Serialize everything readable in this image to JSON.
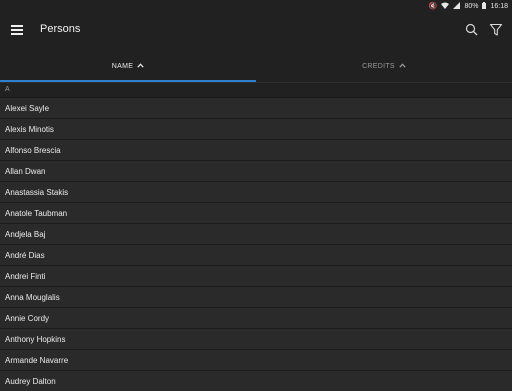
{
  "status_bar": {
    "battery": "80%",
    "time": "16:18",
    "icons": [
      "mute-icon",
      "wifi-icon",
      "signal-icon",
      "battery-icon"
    ]
  },
  "app_bar": {
    "title": "Persons",
    "icons": [
      "menu-icon",
      "search-icon",
      "filter-icon"
    ]
  },
  "tabs": [
    {
      "label": "NAME",
      "sort_arrow": "up",
      "active": true
    },
    {
      "label": "CREDITS",
      "sort_arrow": "up",
      "active": false
    }
  ],
  "colors": {
    "background": "#212121",
    "row": "#2a2a2a",
    "accent": "#2f7fd1"
  },
  "section": "A",
  "persons": [
    "Alexei Sayle",
    "Alexis Minotis",
    "Alfonso Brescia",
    "Allan Dwan",
    "Anastassia Stakis",
    "Anatole Taubman",
    "Andjela Baj",
    "André Dias",
    "Andrei Finti",
    "Anna Mouglalis",
    "Annie Cordy",
    "Anthony Hopkins",
    "Armande Navarre",
    "Audrey Dalton"
  ]
}
